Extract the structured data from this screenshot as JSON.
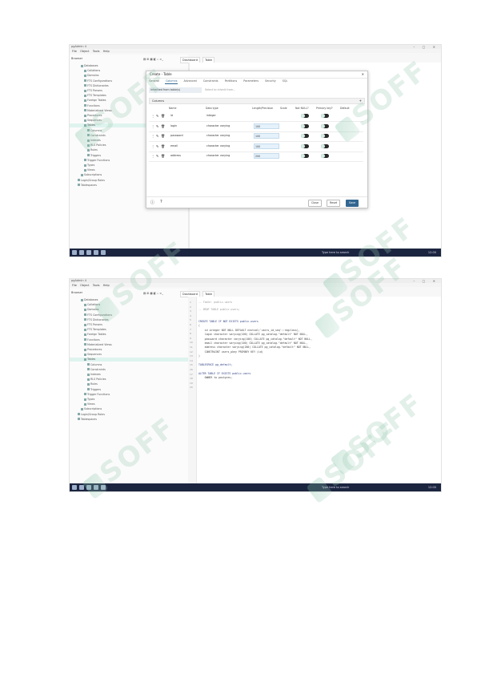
{
  "window": {
    "title": "pgAdmin 4",
    "menu": [
      "File",
      "Object",
      "Tools",
      "Help"
    ],
    "controls": "– ▢ ✕"
  },
  "browser": {
    "header": "Browser",
    "toolbar": "▤ ⊞ ▦ ◧ ⌕ >_",
    "tabs": [
      "Dashboard",
      "Table"
    ]
  },
  "tree1": [
    "Databases",
    "Collations",
    "Domains",
    "FTS Configurations",
    "FTS Dictionaries",
    "FTS Parsers",
    "FTS Templates",
    "Foreign Tables",
    "Functions",
    "Materialized Views",
    "Procedures",
    "Sequences",
    "Tables",
    "Columns",
    "Constraints",
    "Indexes",
    "RLS Policies",
    "Rules",
    "Triggers",
    "Trigger Functions",
    "Types",
    "Views",
    "Subscriptions",
    "Login/Group Roles",
    "Tablespaces"
  ],
  "tree2": [
    "Databases",
    "Collations",
    "Domains",
    "FTS Configurations",
    "FTS Dictionaries",
    "FTS Parsers",
    "FTS Templates",
    "Foreign Tables",
    "Functions",
    "Materialized Views",
    "Procedures",
    "Sequences",
    "Tables",
    "Columns",
    "Constraints",
    "Indexes",
    "RLS Policies",
    "Rules",
    "Triggers",
    "Trigger Functions",
    "Types",
    "Views",
    "Subscriptions",
    "Login/Group Roles",
    "Tablespaces"
  ],
  "dialog": {
    "title": "Create - Table",
    "close": "✕",
    "tabs": [
      "General",
      "Columns",
      "Advanced",
      "Constraints",
      "Partitions",
      "Parameters",
      "Security",
      "SQL"
    ],
    "field_label": "Inherited from table(s)",
    "field_value": "Select to inherit from...",
    "grid_title": "Columns",
    "add": "+",
    "columns": [
      "Name",
      "Data type",
      "Length/Precision",
      "Scale",
      "Not NULL?",
      "Primary key?",
      "Default"
    ],
    "rows": [
      {
        "name": "id",
        "type": "integer",
        "length": ""
      },
      {
        "name": "login",
        "type": "character varying",
        "length": "100"
      },
      {
        "name": "password",
        "type": "character varying",
        "length": "100"
      },
      {
        "name": "email",
        "type": "character varying",
        "length": "100"
      },
      {
        "name": "address",
        "type": "character varying",
        "length": "200"
      }
    ],
    "buttons": {
      "close": "Close",
      "reset": "Reset",
      "save": "Save"
    }
  },
  "sql": {
    "comments": [
      "-- Table: public.users",
      "-- DROP TABLE public.users;"
    ],
    "lines": [
      "CREATE TABLE IF NOT EXISTS public.users",
      "(",
      "    id integer NOT NULL DEFAULT nextval('users_id_seq'::regclass),",
      "    login character varying(100) COLLATE pg_catalog.\"default\" NOT NULL,",
      "    password character varying(100) COLLATE pg_catalog.\"default\" NOT NULL,",
      "    email character varying(100) COLLATE pg_catalog.\"default\" NOT NULL,",
      "    address character varying(200) COLLATE pg_catalog.\"default\" NOT NULL,",
      "    CONSTRAINT users_pkey PRIMARY KEY (id)",
      ")",
      "",
      "TABLESPACE pg_default;",
      "",
      "ALTER TABLE IF EXISTS public.users",
      "    OWNER to postgres;"
    ],
    "line_numbers": [
      "1",
      "2",
      "3",
      "4",
      "5",
      "6",
      "7",
      "8",
      "9",
      "10",
      "11",
      "12",
      "13",
      "14",
      "15",
      "16",
      "17",
      "18",
      "19",
      "20"
    ]
  },
  "taskbar": {
    "search": "Type here to search",
    "clock": "12:00"
  },
  "watermark": "SOFF"
}
